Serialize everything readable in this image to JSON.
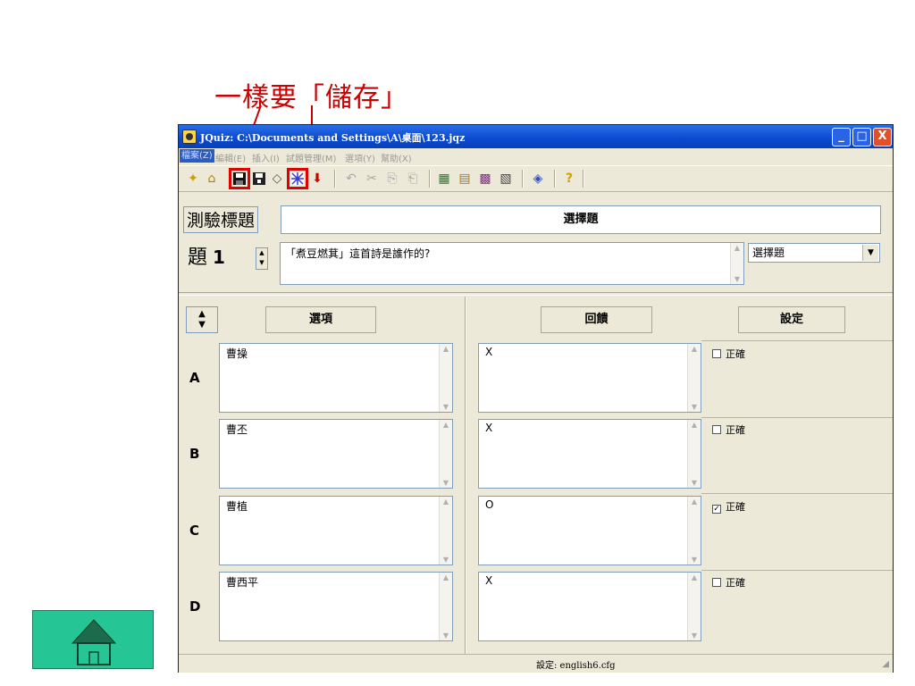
{
  "annotation": "一樣要「儲存」",
  "window": {
    "title": "JQuiz: C:\\Documents and Settings\\A\\桌面\\123.jqz",
    "min": "_",
    "max": "□",
    "close": "X"
  },
  "menu": [
    "檔案(Z)",
    "編輯(E)",
    "插入(I)",
    "試題管理(M)",
    "選項(Y)",
    "幫助(X)"
  ],
  "toolbar": {
    "icons": [
      "new-icon",
      "open-icon",
      "save-icon",
      "save-as-icon",
      "eraser-icon",
      "export-web-icon",
      "down-arrow-icon",
      "undo-icon",
      "cut-icon",
      "copy-icon",
      "paste-icon",
      "exercise-icon",
      "config-icon",
      "tool-icon",
      "tool2-icon",
      "color-icon",
      "help-icon"
    ]
  },
  "quiz": {
    "title_label": "測驗標題",
    "title_value": "選擇題",
    "question_label": "題",
    "question_number": "1",
    "question_text": "「煮豆燃萁」這首詩是誰作的?",
    "question_type": "選擇題"
  },
  "headers": {
    "options": "選項",
    "feedback": "回饋",
    "settings": "設定"
  },
  "rows": [
    {
      "letter": "A",
      "option": "曹操",
      "feedback": "X",
      "correct_label": "正確",
      "correct": false
    },
    {
      "letter": "B",
      "option": "曹丕",
      "feedback": "X",
      "correct_label": "正確",
      "correct": false
    },
    {
      "letter": "C",
      "option": "曹植",
      "feedback": "O",
      "correct_label": "正確",
      "correct": true
    },
    {
      "letter": "D",
      "option": "曹西平",
      "feedback": "X",
      "correct_label": "正確",
      "correct": false
    }
  ],
  "status": "設定: english6.cfg",
  "colors": {
    "annotation": "#cc0000",
    "home_button": "#26c595",
    "titlebar": "#0a4ad0"
  }
}
